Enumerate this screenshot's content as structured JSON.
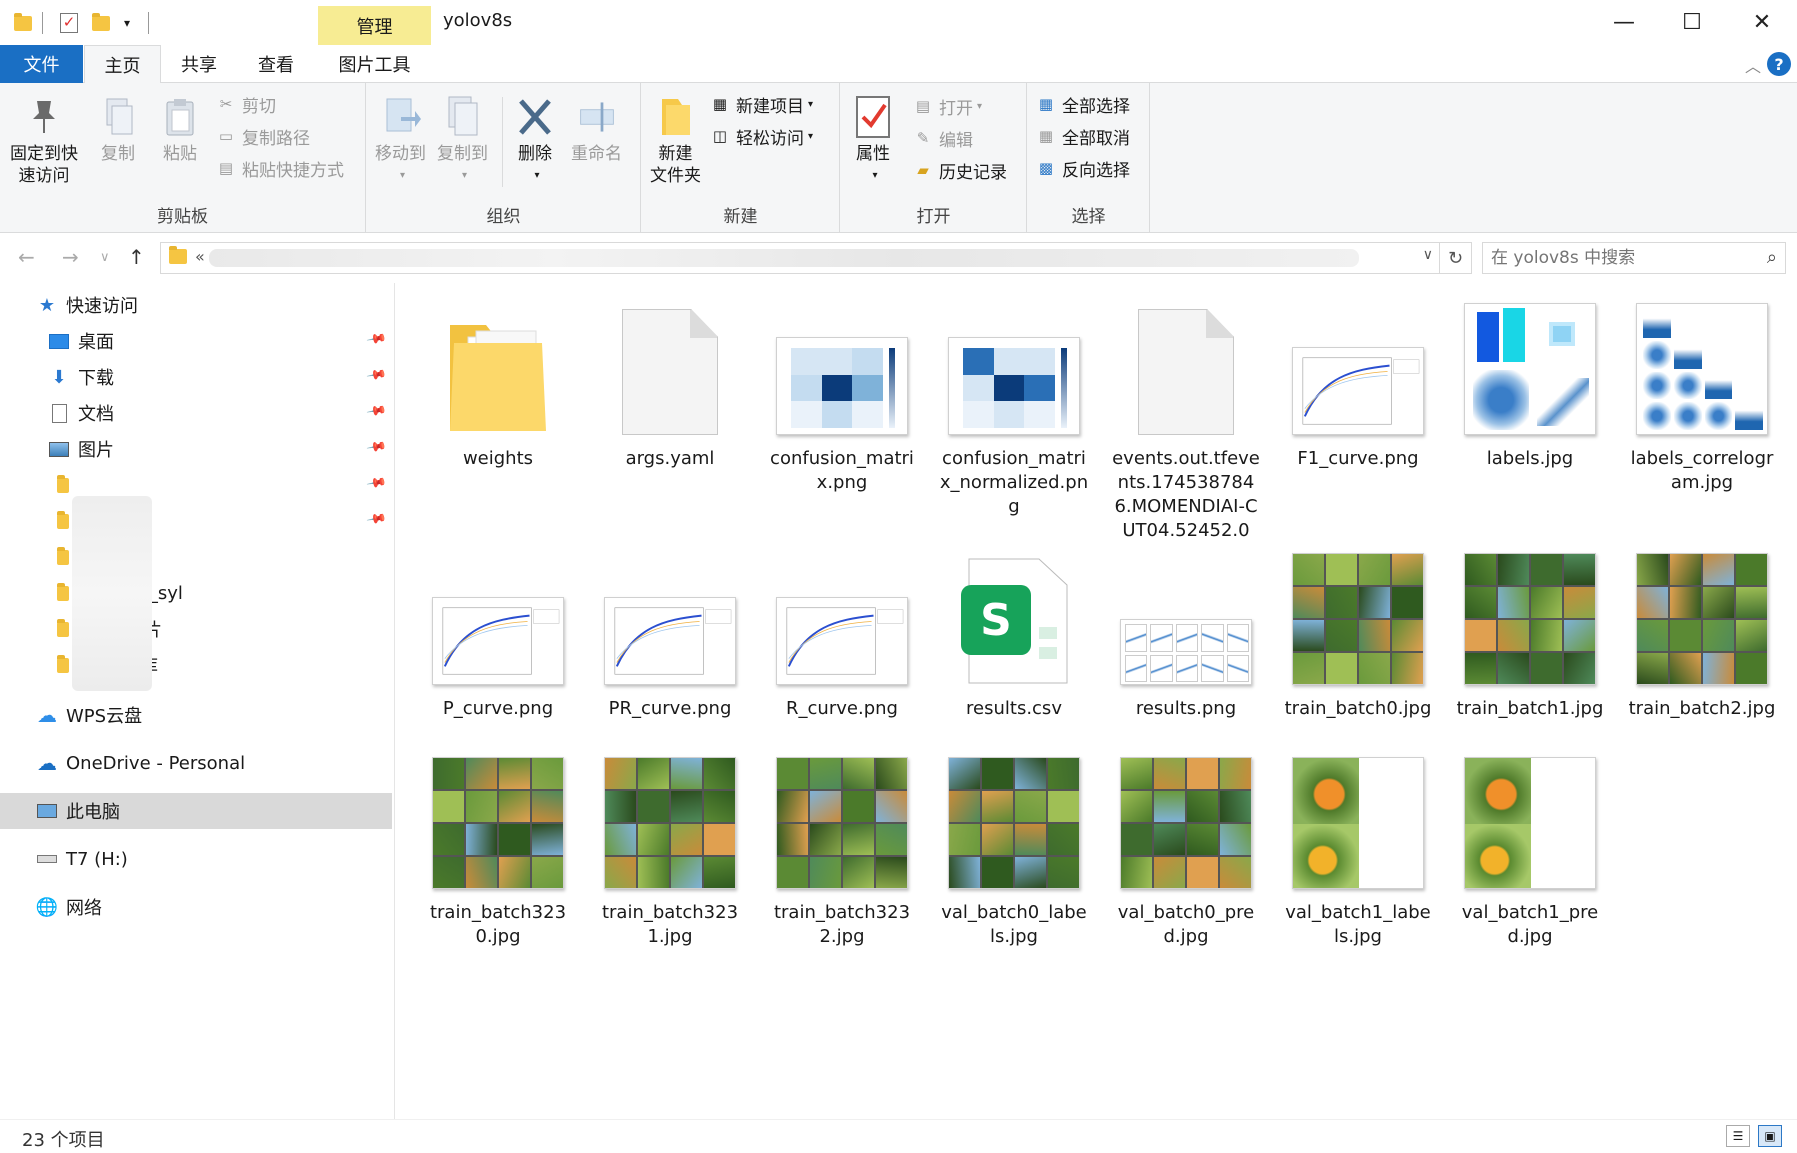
{
  "window": {
    "title": "yolov8s",
    "context_tab": "管理",
    "minimize_glyph": "—",
    "maximize_glyph": "☐",
    "close_glyph": "✕"
  },
  "tabs": [
    {
      "label": "文件"
    },
    {
      "label": "主页"
    },
    {
      "label": "共享"
    },
    {
      "label": "查看"
    },
    {
      "label": "图片工具"
    }
  ],
  "ribbon": {
    "clipboard": {
      "label": "剪贴板",
      "pin_line1": "固定到快",
      "pin_line2": "速访问",
      "copy": "复制",
      "paste": "粘贴",
      "cut": "剪切",
      "copy_path": "复制路径",
      "paste_shortcut": "粘贴快捷方式"
    },
    "organize": {
      "label": "组织",
      "move_to": "移动到",
      "copy_to": "复制到",
      "delete": "删除",
      "rename": "重命名"
    },
    "new": {
      "label": "新建",
      "new_folder_line1": "新建",
      "new_folder_line2": "文件夹",
      "new_item": "新建项目",
      "easy_access": "轻松访问"
    },
    "open": {
      "label": "打开",
      "properties": "属性",
      "open": "打开",
      "edit": "编辑",
      "history": "历史记录"
    },
    "select": {
      "label": "选择",
      "select_all": "全部选择",
      "select_none": "全部取消",
      "invert": "反向选择"
    }
  },
  "address": {
    "prefix": "«",
    "search_placeholder": "在 yolov8s 中搜索"
  },
  "nav": {
    "quick_access": "快速访问",
    "desktop": "桌面",
    "downloads": "下载",
    "documents": "文档",
    "pictures": "图片",
    "partial1": "08_syl",
    "partial2": "片",
    "partial3": "库",
    "wps": "WPS云盘",
    "onedrive": "OneDrive - Personal",
    "this_pc": "此电脑",
    "drive": "T7 (H:)",
    "network": "网络"
  },
  "files": [
    {
      "name": "weights",
      "kind": "folder"
    },
    {
      "name": "args.yaml",
      "kind": "doc"
    },
    {
      "name": "confusion_matrix.png",
      "kind": "matrix"
    },
    {
      "name": "confusion_matrix_normalized.png",
      "kind": "matrix2"
    },
    {
      "name": "events.out.tfevents.1745387846.MOMENDIAI-CUT04.52452.0",
      "kind": "doc"
    },
    {
      "name": "F1_curve.png",
      "kind": "curve"
    },
    {
      "name": "labels.jpg",
      "kind": "labels"
    },
    {
      "name": "labels_correlogram.jpg",
      "kind": "correlogram"
    },
    {
      "name": "P_curve.png",
      "kind": "curve"
    },
    {
      "name": "PR_curve.png",
      "kind": "curve"
    },
    {
      "name": "R_curve.png",
      "kind": "curve"
    },
    {
      "name": "results.csv",
      "kind": "csv"
    },
    {
      "name": "results.png",
      "kind": "results"
    },
    {
      "name": "train_batch0.jpg",
      "kind": "mosaic"
    },
    {
      "name": "train_batch1.jpg",
      "kind": "mosaic"
    },
    {
      "name": "train_batch2.jpg",
      "kind": "mosaic"
    },
    {
      "name": "train_batch3230.jpg",
      "kind": "mosaic"
    },
    {
      "name": "train_batch3231.jpg",
      "kind": "mosaic"
    },
    {
      "name": "train_batch3232.jpg",
      "kind": "mosaic"
    },
    {
      "name": "val_batch0_labels.jpg",
      "kind": "mosaic"
    },
    {
      "name": "val_batch0_pred.jpg",
      "kind": "mosaic"
    },
    {
      "name": "val_batch1_labels.jpg",
      "kind": "fruit"
    },
    {
      "name": "val_batch1_pred.jpg",
      "kind": "fruit"
    }
  ],
  "status": {
    "count": "23 个项目"
  }
}
